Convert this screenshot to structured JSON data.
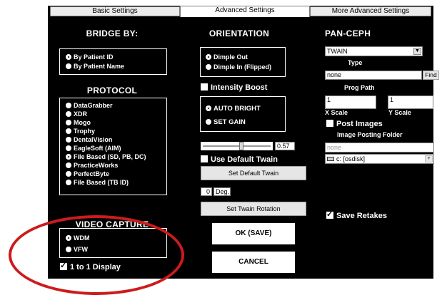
{
  "tabs": [
    "Basic Settings",
    "Advanced Settings",
    "More Advanced Settings"
  ],
  "bridge": {
    "heading": "BRIDGE BY:",
    "options": [
      "By Patient ID",
      "By Patient Name"
    ],
    "selected": 0
  },
  "protocol": {
    "heading": "PROTOCOL",
    "options": [
      "DataGrabber",
      "XDR",
      "Mogo",
      "Trophy",
      "DentalVision",
      "EagleSoft (AIM)",
      "File Based (SD, PB, DC)",
      "PracticeWorks",
      "PerfectByte",
      "File Based (TB ID)"
    ],
    "selected": 6
  },
  "video": {
    "heading": "VIDEO CAPTURE",
    "options": [
      "WDM",
      "VFW"
    ],
    "selected": 0,
    "one_to_one_label": "1 to 1 Display",
    "one_to_one_checked": true
  },
  "orientation": {
    "heading": "ORIENTATION",
    "options": [
      "Dimple Out",
      "Dimple In (Flipped)"
    ],
    "selected": 0
  },
  "intensity_boost": {
    "label": "Intensity Boost",
    "checked": false
  },
  "brightness": {
    "options": [
      "AUTO BRIGHT",
      "SET GAIN"
    ],
    "selected": 0
  },
  "gain_slider": {
    "value_text": "0.57",
    "level": 0.57
  },
  "default_twain": {
    "checkbox_label": "Use Default Twain",
    "checked": false,
    "button_label": "Set Default Twain"
  },
  "rotation": {
    "value": "0",
    "unit": "Deg.",
    "button_label": "Set Twain Rotation"
  },
  "ok_label": "OK (SAVE)",
  "cancel_label": "CANCEL",
  "panceph": {
    "heading": "PAN-CEPH",
    "type_value": "TWAIN",
    "type_label": "Type",
    "prog_path_value": "none",
    "find_label": "Find",
    "prog_path_label": "Prog Path",
    "x_scale_value": "1",
    "y_scale_value": "1",
    "x_scale_label": "X Scale",
    "y_scale_label": "Y Scale",
    "post_images_label": "Post Images",
    "post_images_checked": false,
    "folder_label": "Image Posting Folder",
    "folder_value": "none",
    "drive_value": "c: [osdisk]"
  },
  "save_retakes": {
    "label": "Save Retakes",
    "checked": true
  },
  "colors": {
    "window_bg": "#000000",
    "annotation": "#cc1b1b"
  },
  "icons": {
    "drive": "drive-icon",
    "dropdown": "chevron-down-icon"
  }
}
